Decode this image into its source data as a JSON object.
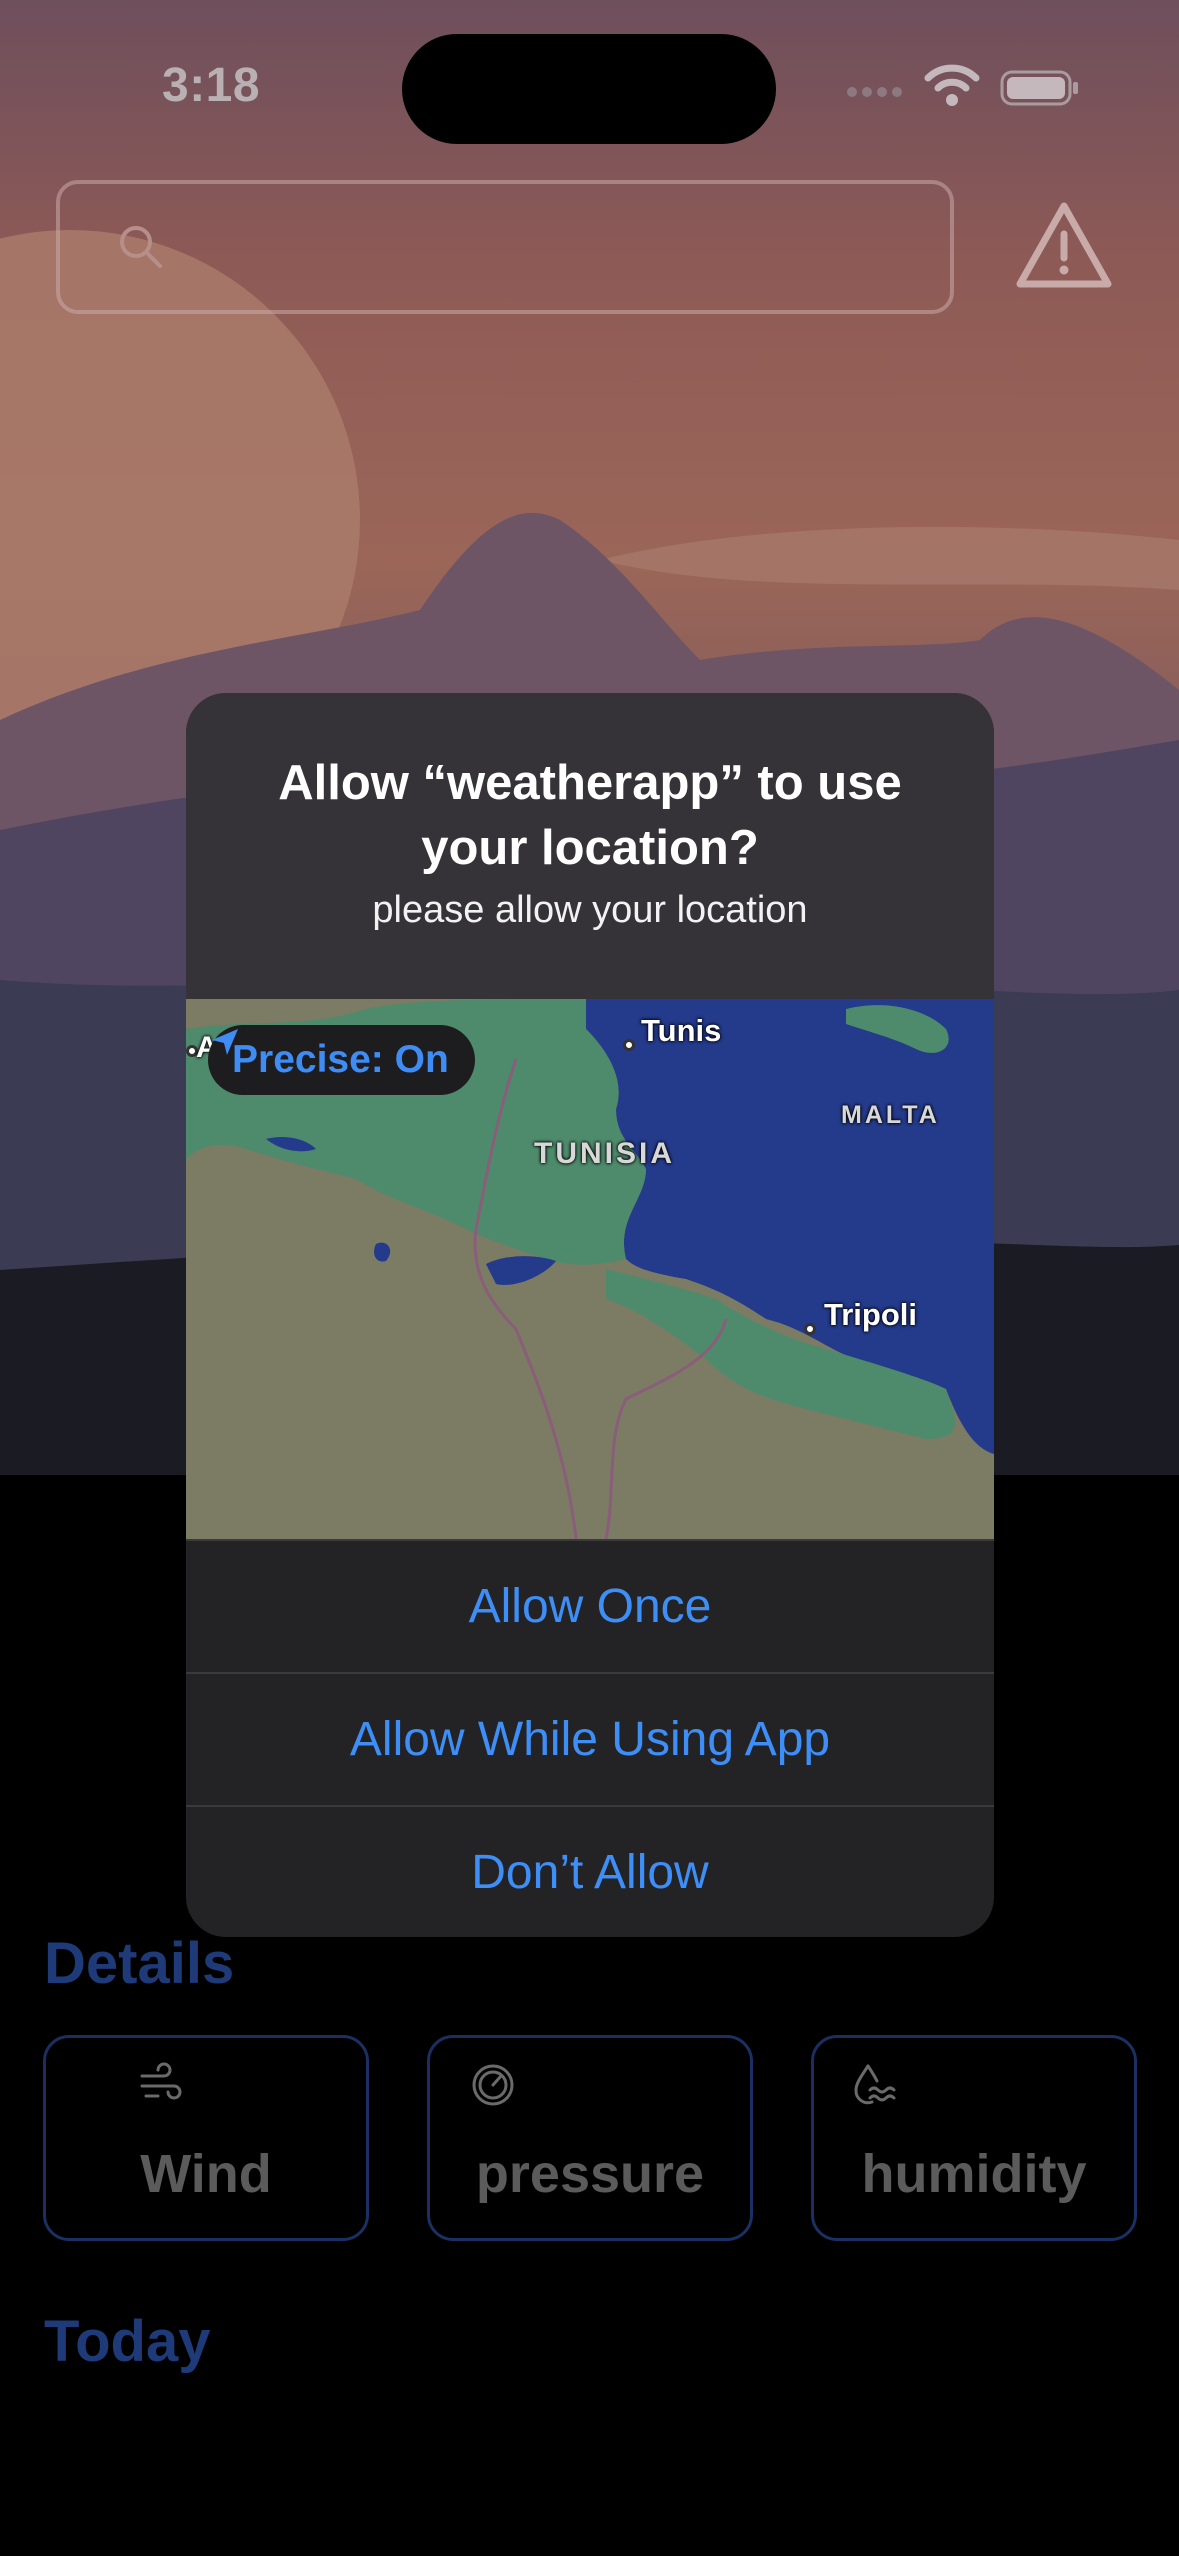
{
  "status": {
    "time": "3:18"
  },
  "search": {
    "placeholder": ""
  },
  "sections": {
    "details": "Details",
    "today": "Today"
  },
  "cards": [
    {
      "label": "Wind",
      "icon": "wind-icon"
    },
    {
      "label": "pressure",
      "icon": "gauge-icon"
    },
    {
      "label": "humidity",
      "icon": "humidity-icon"
    }
  ],
  "dialog": {
    "title": "Allow “weatherapp” to use your location?",
    "message": "please allow your location",
    "precise_label": "Precise: On",
    "map_labels": {
      "city1": "Tunis",
      "city2": "Tripoli",
      "country1": "TUNISIA",
      "country2": "MALTA",
      "cut": "Al"
    },
    "buttons": {
      "allow_once": "Allow Once",
      "allow_while_using": "Allow While Using App",
      "dont_allow": "Don’t Allow"
    }
  },
  "colors": {
    "accent": "#3e8ef7",
    "section": "#1e3a78",
    "dialog_bg": "#232325"
  }
}
